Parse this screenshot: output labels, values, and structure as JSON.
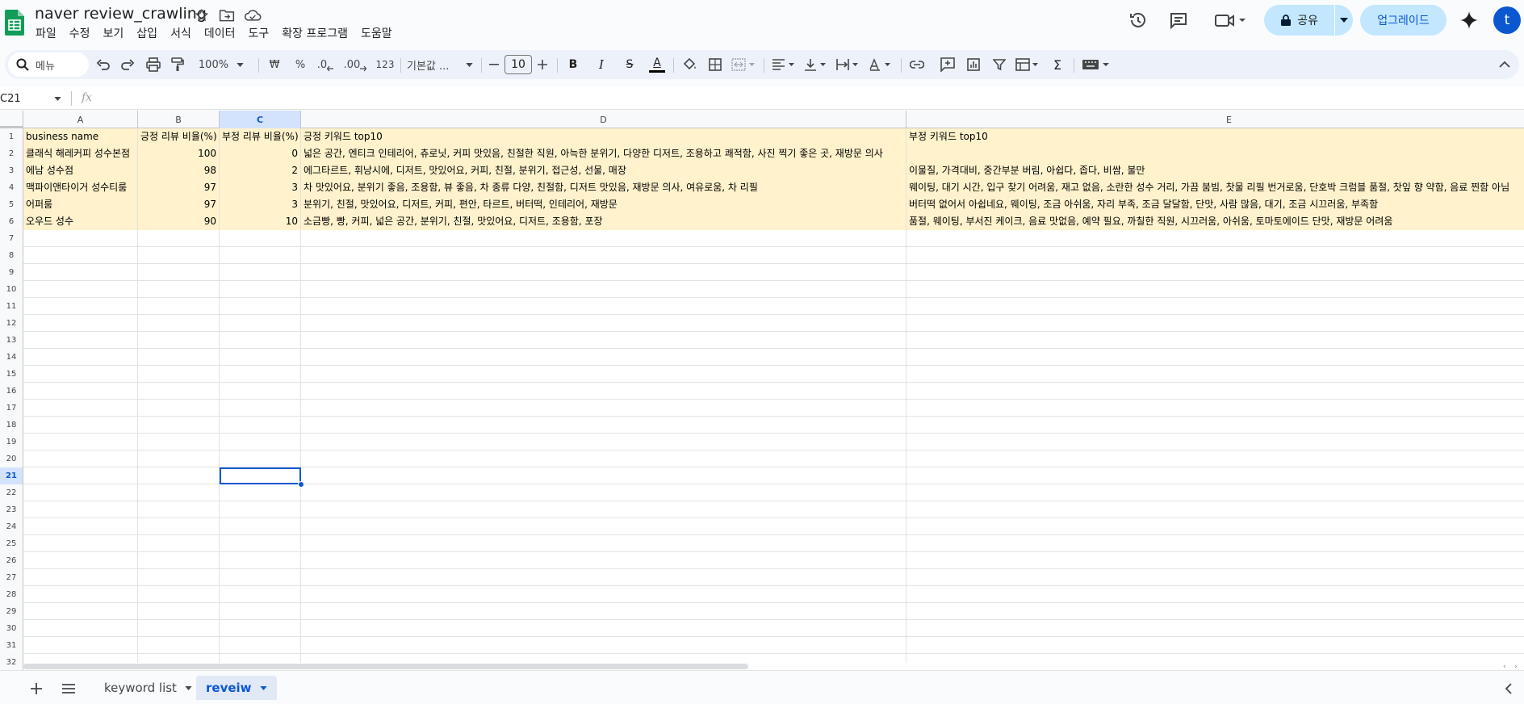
{
  "app": {
    "doc_title": "naver review_crawling",
    "menu": [
      "파일",
      "수정",
      "보기",
      "삽입",
      "서식",
      "데이터",
      "도구",
      "확장 프로그램",
      "도움말"
    ],
    "share_label": "공유",
    "upgrade_label": "업그레이드",
    "avatar_letter": "t"
  },
  "toolbar": {
    "search_placeholder": "메뉴",
    "zoom": "100%",
    "currency": "₩",
    "percent": "%",
    "dec_decrease": ".0",
    "dec_increase": ".00",
    "number_format": "123",
    "font_name": "기본값 ...",
    "font_size": "10",
    "bold": "B",
    "italic": "I",
    "strike": "S",
    "text_color_letter": "A",
    "sum": "Σ"
  },
  "formula_bar": {
    "name_box": "C21",
    "fx": "fx"
  },
  "grid": {
    "columns": [
      "A",
      "B",
      "C",
      "D",
      "E"
    ],
    "selected_column": "C",
    "selected_row": "21",
    "row_numbers": [
      "1",
      "2",
      "3",
      "4",
      "5",
      "6",
      "7",
      "8",
      "9",
      "10",
      "11",
      "12",
      "13",
      "14",
      "15",
      "16",
      "17",
      "18",
      "19",
      "20",
      "21",
      "22",
      "23",
      "24",
      "25",
      "26",
      "27",
      "28",
      "29",
      "30",
      "31",
      "32"
    ],
    "rows": [
      [
        "business name",
        "긍정 리뷰 비율(%)",
        "부정 리뷰 비율(%)",
        "긍정 키워드 top10",
        "부정 키워드 top10"
      ],
      [
        "클래식 해레커피 성수본점",
        "100",
        "0",
        "넓은 공간, 엔티크 인테리어, 츄로닛, 커피 맛있음, 친절한 직원, 아늑한 분위기, 다양한 디저트, 조용하고 쾌적함, 사진 찍기 좋은 곳, 재방문 의사",
        ""
      ],
      [
        "에남 성수점",
        "98",
        "2",
        "에그타르트, 휘낭시에, 디저트, 맛있어요, 커피, 친절, 분위기, 접근성, 선물, 매장",
        "이물질, 가격대비, 중간부분 버림, 아쉽다, 좁다, 비쌈, 불만"
      ],
      [
        "맥파이앤타이거 성수티룸",
        "97",
        "3",
        "차 맛있어요, 분위기 좋음, 조용함, 뷰 좋음, 차 종류 다양, 친절함, 디저트 맛있음, 재방문 의사, 여유로움, 차 리필",
        "웨이팅, 대기 시간, 입구 찾기 어려움, 재고 없음, 소란한 성수 거리, 가끔 붐빔, 찻물 리필 번거로움, 단호박 크럼블 품절, 찻잎 향 약함, 음료 찐함 아님"
      ],
      [
        "어퍼룸",
        "97",
        "3",
        "분위기, 친절, 맛있어요, 디저트, 커피, 편안, 타르트, 버터떡, 인테리어, 재방문",
        "버터떡 없어서 아쉽네요, 웨이팅, 조금 아쉬움, 자리 부족, 조금 달달함, 단맛, 사람 많음, 대기, 조금 시끄러움, 부족함"
      ],
      [
        "오우드 성수",
        "90",
        "10",
        "소금빵, 빵, 커피, 넓은 공간, 분위기, 친절, 맛있어요, 디저트, 조용함, 포장",
        "품절, 웨이팅, 부서진 케이크, 음료 맛없음, 예약 필요, 까칠한 직원, 시끄러움, 아쉬움, 토마토에이드 단맛, 재방문 어려움"
      ]
    ]
  },
  "tabs": [
    {
      "label": "keyword list",
      "active": false
    },
    {
      "label": "reveiw",
      "active": true
    }
  ],
  "colors": {
    "accent": "#0b57d0",
    "highlight_fill": "#fff2cc",
    "share_bg": "#c2e7ff",
    "logo_green": "#0f9d58"
  }
}
